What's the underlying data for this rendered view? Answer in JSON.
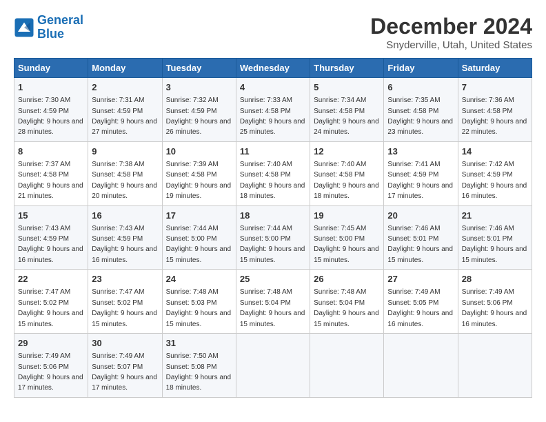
{
  "logo": {
    "line1": "General",
    "line2": "Blue"
  },
  "title": "December 2024",
  "location": "Snyderville, Utah, United States",
  "days_of_week": [
    "Sunday",
    "Monday",
    "Tuesday",
    "Wednesday",
    "Thursday",
    "Friday",
    "Saturday"
  ],
  "weeks": [
    [
      {
        "day": "1",
        "sunrise": "7:30 AM",
        "sunset": "4:59 PM",
        "daylight": "9 hours and 28 minutes."
      },
      {
        "day": "2",
        "sunrise": "7:31 AM",
        "sunset": "4:59 PM",
        "daylight": "9 hours and 27 minutes."
      },
      {
        "day": "3",
        "sunrise": "7:32 AM",
        "sunset": "4:59 PM",
        "daylight": "9 hours and 26 minutes."
      },
      {
        "day": "4",
        "sunrise": "7:33 AM",
        "sunset": "4:58 PM",
        "daylight": "9 hours and 25 minutes."
      },
      {
        "day": "5",
        "sunrise": "7:34 AM",
        "sunset": "4:58 PM",
        "daylight": "9 hours and 24 minutes."
      },
      {
        "day": "6",
        "sunrise": "7:35 AM",
        "sunset": "4:58 PM",
        "daylight": "9 hours and 23 minutes."
      },
      {
        "day": "7",
        "sunrise": "7:36 AM",
        "sunset": "4:58 PM",
        "daylight": "9 hours and 22 minutes."
      }
    ],
    [
      {
        "day": "8",
        "sunrise": "7:37 AM",
        "sunset": "4:58 PM",
        "daylight": "9 hours and 21 minutes."
      },
      {
        "day": "9",
        "sunrise": "7:38 AM",
        "sunset": "4:58 PM",
        "daylight": "9 hours and 20 minutes."
      },
      {
        "day": "10",
        "sunrise": "7:39 AM",
        "sunset": "4:58 PM",
        "daylight": "9 hours and 19 minutes."
      },
      {
        "day": "11",
        "sunrise": "7:40 AM",
        "sunset": "4:58 PM",
        "daylight": "9 hours and 18 minutes."
      },
      {
        "day": "12",
        "sunrise": "7:40 AM",
        "sunset": "4:58 PM",
        "daylight": "9 hours and 18 minutes."
      },
      {
        "day": "13",
        "sunrise": "7:41 AM",
        "sunset": "4:59 PM",
        "daylight": "9 hours and 17 minutes."
      },
      {
        "day": "14",
        "sunrise": "7:42 AM",
        "sunset": "4:59 PM",
        "daylight": "9 hours and 16 minutes."
      }
    ],
    [
      {
        "day": "15",
        "sunrise": "7:43 AM",
        "sunset": "4:59 PM",
        "daylight": "9 hours and 16 minutes."
      },
      {
        "day": "16",
        "sunrise": "7:43 AM",
        "sunset": "4:59 PM",
        "daylight": "9 hours and 16 minutes."
      },
      {
        "day": "17",
        "sunrise": "7:44 AM",
        "sunset": "5:00 PM",
        "daylight": "9 hours and 15 minutes."
      },
      {
        "day": "18",
        "sunrise": "7:44 AM",
        "sunset": "5:00 PM",
        "daylight": "9 hours and 15 minutes."
      },
      {
        "day": "19",
        "sunrise": "7:45 AM",
        "sunset": "5:00 PM",
        "daylight": "9 hours and 15 minutes."
      },
      {
        "day": "20",
        "sunrise": "7:46 AM",
        "sunset": "5:01 PM",
        "daylight": "9 hours and 15 minutes."
      },
      {
        "day": "21",
        "sunrise": "7:46 AM",
        "sunset": "5:01 PM",
        "daylight": "9 hours and 15 minutes."
      }
    ],
    [
      {
        "day": "22",
        "sunrise": "7:47 AM",
        "sunset": "5:02 PM",
        "daylight": "9 hours and 15 minutes."
      },
      {
        "day": "23",
        "sunrise": "7:47 AM",
        "sunset": "5:02 PM",
        "daylight": "9 hours and 15 minutes."
      },
      {
        "day": "24",
        "sunrise": "7:48 AM",
        "sunset": "5:03 PM",
        "daylight": "9 hours and 15 minutes."
      },
      {
        "day": "25",
        "sunrise": "7:48 AM",
        "sunset": "5:04 PM",
        "daylight": "9 hours and 15 minutes."
      },
      {
        "day": "26",
        "sunrise": "7:48 AM",
        "sunset": "5:04 PM",
        "daylight": "9 hours and 15 minutes."
      },
      {
        "day": "27",
        "sunrise": "7:49 AM",
        "sunset": "5:05 PM",
        "daylight": "9 hours and 16 minutes."
      },
      {
        "day": "28",
        "sunrise": "7:49 AM",
        "sunset": "5:06 PM",
        "daylight": "9 hours and 16 minutes."
      }
    ],
    [
      {
        "day": "29",
        "sunrise": "7:49 AM",
        "sunset": "5:06 PM",
        "daylight": "9 hours and 17 minutes."
      },
      {
        "day": "30",
        "sunrise": "7:49 AM",
        "sunset": "5:07 PM",
        "daylight": "9 hours and 17 minutes."
      },
      {
        "day": "31",
        "sunrise": "7:50 AM",
        "sunset": "5:08 PM",
        "daylight": "9 hours and 18 minutes."
      },
      null,
      null,
      null,
      null
    ]
  ]
}
